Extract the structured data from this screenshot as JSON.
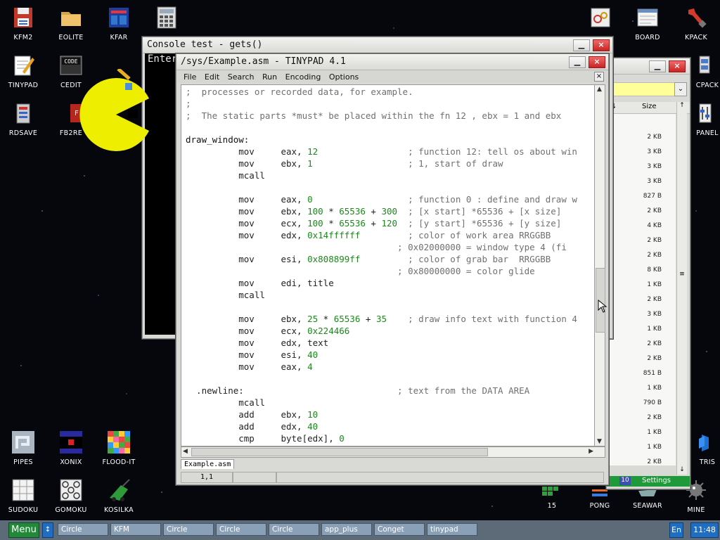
{
  "desktop_icons": [
    {
      "id": "kfm2",
      "label": "KFM2"
    },
    {
      "id": "eolite",
      "label": "EOLITE"
    },
    {
      "id": "kfar",
      "label": "KFAR"
    },
    {
      "id": "calc",
      "label": ""
    },
    {
      "id": "tinypad",
      "label": "TINYPAD"
    },
    {
      "id": "cedit",
      "label": "CEDIT"
    },
    {
      "id": "rdsave",
      "label": "RDSAVE"
    },
    {
      "id": "fb2read",
      "label": "FB2RE"
    },
    {
      "id": "board",
      "label": "BOARD"
    },
    {
      "id": "kpack",
      "label": "KPACK"
    },
    {
      "id": "cpack",
      "label": "CPACK"
    },
    {
      "id": "panel",
      "label": "PANEL"
    },
    {
      "id": "pipes",
      "label": "PIPES"
    },
    {
      "id": "xonix",
      "label": "XONIX"
    },
    {
      "id": "floodit",
      "label": "FLOOD-IT"
    },
    {
      "id": "sudoku",
      "label": "SUDOKU"
    },
    {
      "id": "gomoku",
      "label": "GOMOKU"
    },
    {
      "id": "kosilka",
      "label": "KOSILKA"
    },
    {
      "id": "n15",
      "label": "15"
    },
    {
      "id": "pong",
      "label": "PONG"
    },
    {
      "id": "seawar",
      "label": "SEAWAR"
    },
    {
      "id": "mine",
      "label": "MINE"
    },
    {
      "id": "tetris",
      "label": "TRIS"
    }
  ],
  "console": {
    "title": "Console test - gets()",
    "text": "Enter"
  },
  "file_manager": {
    "size_header": "Size",
    "sizes": [
      "2 KB",
      "3 KB",
      "3 KB",
      "3 KB",
      "827 B",
      "2 KB",
      "4 KB",
      "2 KB",
      "2 KB",
      "8 KB",
      "1 KB",
      "2 KB",
      "3 KB",
      "1 KB",
      "2 KB",
      "2 KB",
      "851 B",
      "1 KB",
      "790 B",
      "2 KB",
      "1 KB",
      "1 KB",
      "2 KB"
    ],
    "bottom_num": "10",
    "bottom_label": "Settings"
  },
  "tinypad": {
    "title": "/sys/Example.asm - TINYPAD 4.1",
    "menu": [
      "File",
      "Edit",
      "Search",
      "Run",
      "Encoding",
      "Options"
    ],
    "tab": "Example.asm",
    "cursor": "1,1"
  },
  "taskbar": {
    "menu_label": "Menu",
    "tasks": [
      "Circle",
      "KFM",
      "Circle",
      "Circle",
      "Circle",
      "app_plus",
      "Conget",
      "tinypad"
    ],
    "lang": "En",
    "clock": "11:48"
  }
}
